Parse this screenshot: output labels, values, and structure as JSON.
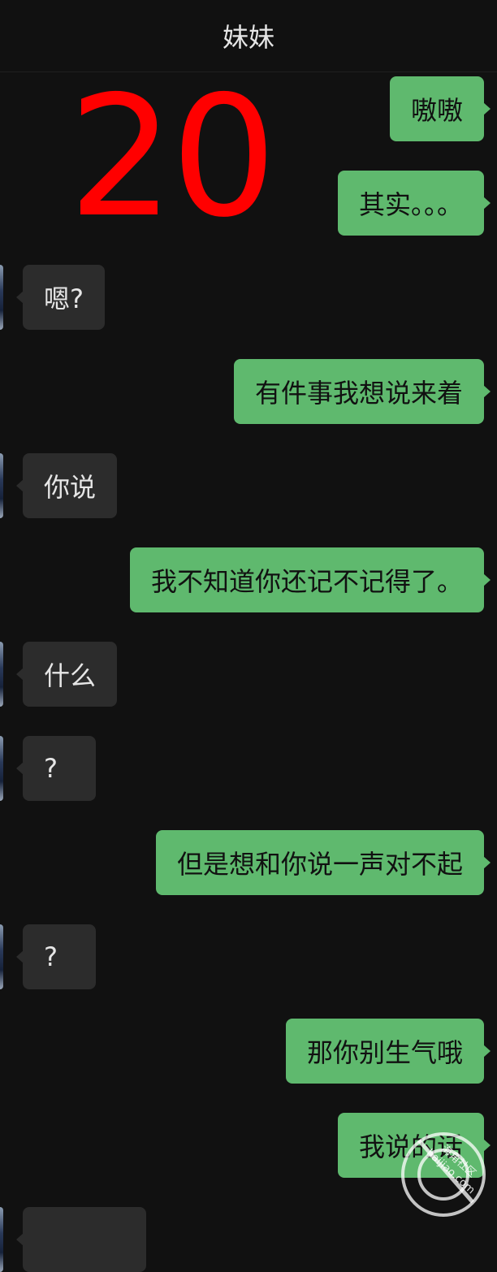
{
  "header": {
    "title": "妹妹"
  },
  "overlay": {
    "big_number": "20"
  },
  "messages": [
    {
      "side": "out",
      "text": "嗷嗷"
    },
    {
      "side": "out",
      "text": "其实。。。"
    },
    {
      "side": "in",
      "text": "嗯?"
    },
    {
      "side": "out",
      "text": "有件事我想说来着"
    },
    {
      "side": "in",
      "text": "你说"
    },
    {
      "side": "out",
      "text": "我不知道你还记不记得了。"
    },
    {
      "side": "in",
      "text": "什么"
    },
    {
      "side": "in",
      "text": "?"
    },
    {
      "side": "out",
      "text": "但是想和你说一声对不起"
    },
    {
      "side": "in",
      "text": "?"
    },
    {
      "side": "out",
      "text": "那你别生气哦"
    },
    {
      "side": "out",
      "text": "我说的话"
    },
    {
      "side": "in",
      "text": ""
    }
  ],
  "watermark": {
    "line1": "海角社区",
    "line2": "haijiao.com"
  },
  "colors": {
    "outgoing_bubble": "#5fb96e",
    "incoming_bubble": "#2c2c2c",
    "background": "#111111",
    "overlay_number": "#ff0000"
  }
}
